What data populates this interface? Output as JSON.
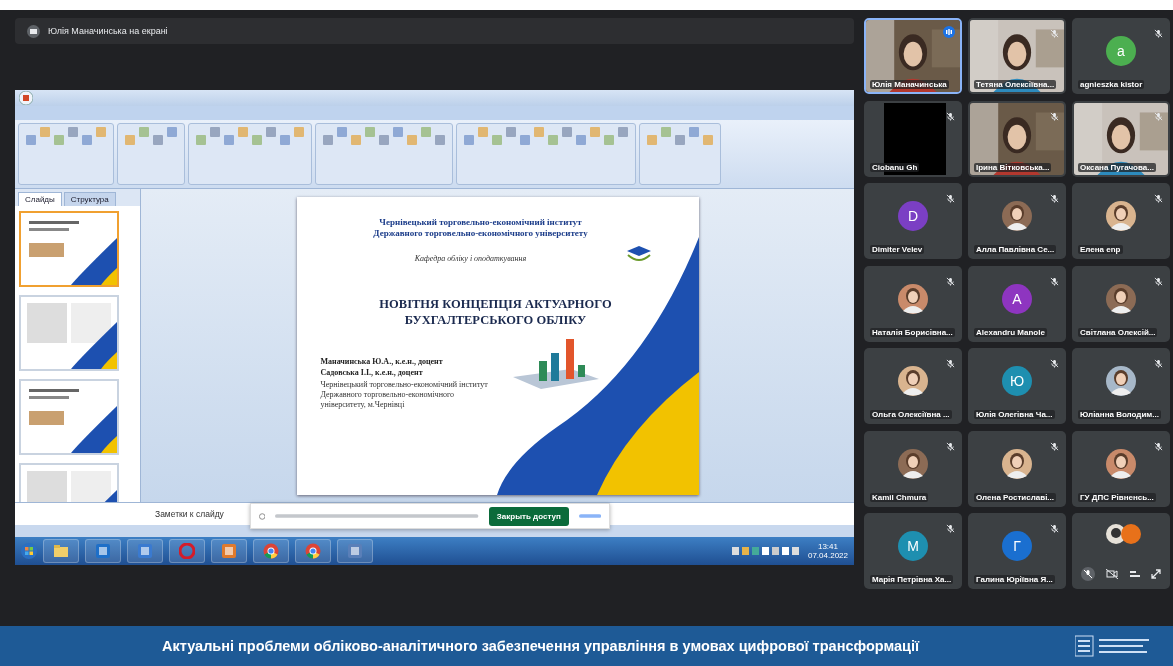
{
  "presenter_bar": {
    "label": "Юлія Маначинська на екрані"
  },
  "powerpoint": {
    "panel_tabs": [
      {
        "label": "Слайды",
        "selected": true
      },
      {
        "label": "Структура",
        "selected": false
      }
    ],
    "thumbnails": [
      {
        "selected": true
      },
      {
        "selected": false
      },
      {
        "selected": false
      },
      {
        "selected": false
      }
    ],
    "slide": {
      "institute": [
        "Чернівецький торговельно-економічний інститут",
        "Державного торговельно-економічного університету"
      ],
      "department": "Кафедра обліку і оподаткування",
      "title": [
        "НОВІТНЯ КОНЦЕПЦІЯ АКТУАРНОГО",
        "БУХГАЛТЕРСЬКОГО ОБЛІКУ"
      ],
      "authors": [
        "Маначинська Ю.А., к.е.н., доцент",
        "Садовська І.І., к.е.н., доцент"
      ],
      "affiliation": "Чернівецький торговельно-економічний інститут Державного торговельно-економічного університету, м.Чернівці"
    },
    "notes_placeholder": "Заметки к слайду",
    "notification": {
      "button": "Закрыть доступ"
    },
    "taskbar": {
      "time": "13:41",
      "date": "07.04.2022"
    }
  },
  "participants": [
    {
      "name": "Юлія Маначинська",
      "kind": "video",
      "speaking": true,
      "muted": false
    },
    {
      "name": "Тетяна Олексіївна...",
      "kind": "video",
      "speaking": false,
      "muted": true
    },
    {
      "name": "agnieszka kistor",
      "kind": "initial",
      "initial": "a",
      "color": "#4caf50",
      "speaking": false,
      "muted": true
    },
    {
      "name": "Ciobanu Gh",
      "kind": "black",
      "speaking": false,
      "muted": true
    },
    {
      "name": "Ірина Вітковська...",
      "kind": "video",
      "speaking": false,
      "muted": true
    },
    {
      "name": "Оксана Пугачова...",
      "kind": "video",
      "speaking": false,
      "muted": true
    },
    {
      "name": "Dimiter Velev",
      "kind": "initial",
      "initial": "D",
      "color": "#7b3fc4",
      "speaking": false,
      "muted": true
    },
    {
      "name": "Алла Павлівна Се...",
      "speaking": false,
      "muted": true
    },
    {
      "name": "Елена enp",
      "speaking": false,
      "muted": true
    },
    {
      "name": "Наталія Борисівна...",
      "speaking": false,
      "muted": true
    },
    {
      "name": "Alexandru Manole",
      "kind": "initial",
      "initial": "A",
      "color": "#8e35c0",
      "speaking": false,
      "muted": true
    },
    {
      "name": "Світлана Олексій...",
      "speaking": false,
      "muted": true
    },
    {
      "name": "Ольга Олексіївна ...",
      "speaking": false,
      "muted": true
    },
    {
      "name": "Юлія Олегівна Ча...",
      "kind": "initial",
      "initial": "Ю",
      "color": "#1e8fb0",
      "speaking": false,
      "muted": true
    },
    {
      "name": "Юліанна Володим...",
      "speaking": false,
      "muted": true
    },
    {
      "name": "Kamil Chmura",
      "speaking": false,
      "muted": true
    },
    {
      "name": "Олена Ростиславі...",
      "speaking": false,
      "muted": true
    },
    {
      "name": "ГУ ДПС Рівненсь...",
      "speaking": false,
      "muted": true
    },
    {
      "name": "Марія Петрівна Ха...",
      "kind": "initial",
      "initial": "M",
      "color": "#1e8fb0",
      "speaking": false,
      "muted": true
    },
    {
      "name": "Галина Юріївна Я...",
      "kind": "initial",
      "initial": "Г",
      "color": "#1a6fd0",
      "speaking": false,
      "muted": true
    },
    {
      "kind": "self_controls"
    }
  ],
  "banner": {
    "title": "Актуальні проблеми обліково-аналітичного забезпечення управління в умовах цифрової трансформації"
  }
}
